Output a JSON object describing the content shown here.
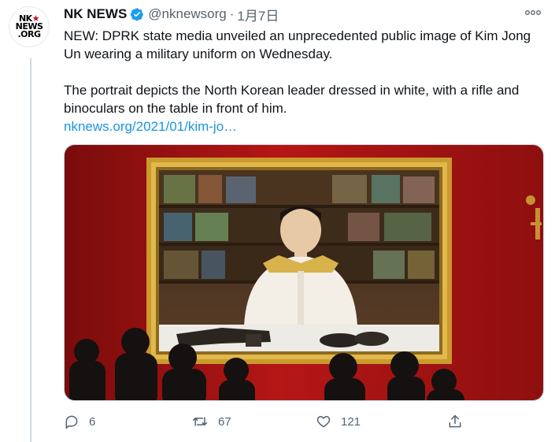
{
  "tweet": {
    "author_name": "NK NEWS",
    "handle": "@nknewsorg",
    "separator": "·",
    "date": "1月7日",
    "avatar_text": {
      "line1a": "NK",
      "line1b": "★",
      "line2": "NEWS",
      "line3": ".ORG"
    },
    "body_line1": "NEW: DPRK state media unveiled an unprecedented public image of Kim Jong Un wearing a military uniform on Wednesday.",
    "body_line2": "The portrait depicts the North Korean leader dressed in white, with a rifle and binoculars on the table in front of him.",
    "link_text": "nknews.org/2021/01/kim-jo…",
    "media": {
      "icon": "photo-of-portrait-in-gold-frame"
    }
  },
  "actions": {
    "reply_count": "6",
    "retweet_count": "67",
    "like_count": "121"
  },
  "colors": {
    "text": "#0f1419",
    "secondary": "#536471",
    "link": "#1b95e0",
    "verified": "#1d9bf0",
    "wall_red": "#a81313"
  },
  "icons": [
    "verified-badge-icon",
    "more-options-icon",
    "reply-icon",
    "retweet-icon",
    "like-icon",
    "share-icon"
  ]
}
